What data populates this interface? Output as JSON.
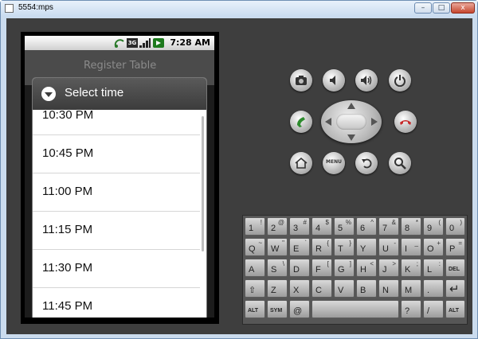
{
  "window": {
    "title": "5554:mps",
    "minimize_label": "–",
    "maximize_label": "□",
    "close_label": "x"
  },
  "status_bar": {
    "time": "7:28 AM",
    "network_badge": "3G"
  },
  "app_header": {
    "title": "Register Table"
  },
  "dialog": {
    "title": "Select time",
    "times": [
      "10:30 PM",
      "10:45 PM",
      "11:00 PM",
      "11:15 PM",
      "11:30 PM",
      "11:45 PM"
    ]
  },
  "controls": {
    "buttons": [
      "camera-icon",
      "volume-down-icon",
      "volume-up-icon",
      "power-icon",
      "call-icon",
      "end-call-icon",
      "home-icon",
      "menu-icon",
      "back-icon",
      "search-icon"
    ],
    "menu_label": "MENU"
  },
  "keyboard": {
    "row1": [
      [
        "1",
        "!"
      ],
      [
        "2",
        "@"
      ],
      [
        "3",
        "#"
      ],
      [
        "4",
        "$"
      ],
      [
        "5",
        "%"
      ],
      [
        "6",
        "^"
      ],
      [
        "7",
        "&"
      ],
      [
        "8",
        "*"
      ],
      [
        "9",
        "("
      ],
      [
        "0",
        ")"
      ]
    ],
    "row2": [
      [
        "Q",
        "~"
      ],
      [
        "W",
        "\""
      ],
      [
        "E",
        "`"
      ],
      [
        "R",
        "{"
      ],
      [
        "T",
        "}"
      ],
      [
        "Y",
        ""
      ],
      [
        "U",
        "-"
      ],
      [
        "I",
        "_"
      ],
      [
        "O",
        "+"
      ],
      [
        "P",
        "="
      ]
    ],
    "row3": [
      [
        "A",
        ""
      ],
      [
        "S",
        "\\"
      ],
      [
        "D",
        ""
      ],
      [
        "F",
        "["
      ],
      [
        "G",
        "]"
      ],
      [
        "H",
        "<"
      ],
      [
        "J",
        ">"
      ],
      [
        "K",
        ";"
      ],
      [
        "L",
        ":"
      ],
      [
        "DEL",
        ""
      ]
    ],
    "row4": [
      [
        "⇧",
        ""
      ],
      [
        "Z",
        ""
      ],
      [
        "X",
        ""
      ],
      [
        "C",
        ""
      ],
      [
        "V",
        ""
      ],
      [
        "B",
        ""
      ],
      [
        "N",
        ""
      ],
      [
        "M",
        ""
      ],
      [
        ".",
        ""
      ],
      [
        "↵",
        ""
      ]
    ],
    "row5": [
      [
        "ALT",
        ""
      ],
      [
        "SYM",
        ""
      ],
      [
        "@",
        ""
      ],
      [
        "",
        ""
      ],
      [
        "?",
        ""
      ],
      [
        "/",
        ""
      ],
      [
        "ALT",
        ""
      ]
    ]
  },
  "colors": {
    "window_frame": "#cbdcee",
    "device": "#3e3e3e",
    "dialog_header": "#4a4a4a",
    "call_green": "#2e8b2e",
    "end_red": "#c62828"
  }
}
